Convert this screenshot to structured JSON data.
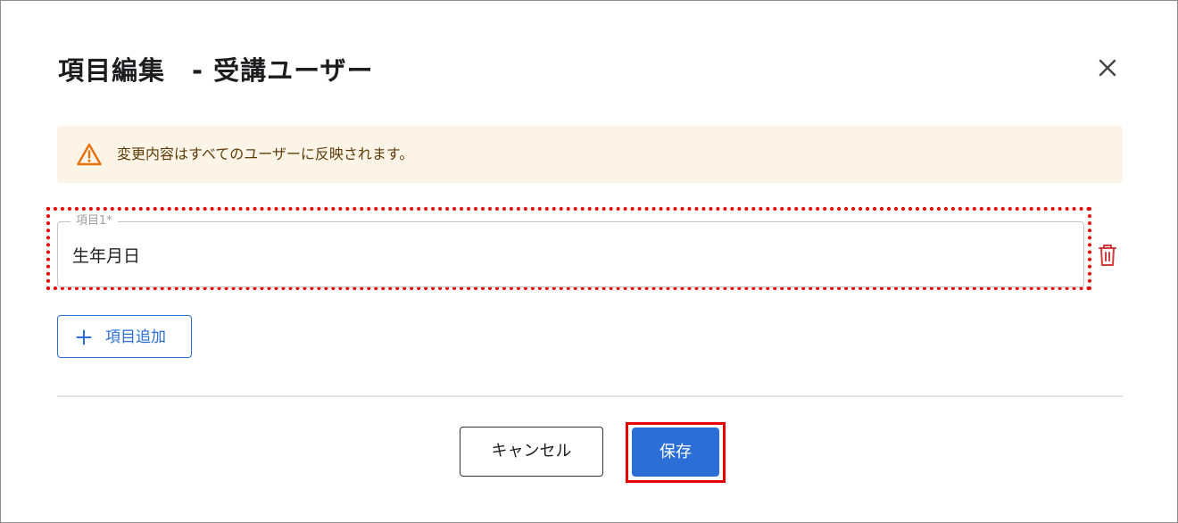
{
  "dialog": {
    "title": "項目編集　- 受講ユーザー",
    "close_icon": "close-icon"
  },
  "alert": {
    "icon": "warning-icon",
    "text": "変更内容はすべてのユーザーに反映されます。",
    "colors": {
      "background": "#fdf4e8",
      "icon": "#e8710a",
      "text": "#5f3b07"
    }
  },
  "fields": [
    {
      "label": "項目1*",
      "value": "生年月日",
      "delete_icon": "trash-icon"
    }
  ],
  "actions": {
    "add_label": "項目追加",
    "add_icon": "plus-icon",
    "cancel_label": "キャンセル",
    "save_label": "保存"
  },
  "colors": {
    "primary": "#2b6fd6",
    "danger": "#d13a3a",
    "highlight": "#e60000"
  }
}
